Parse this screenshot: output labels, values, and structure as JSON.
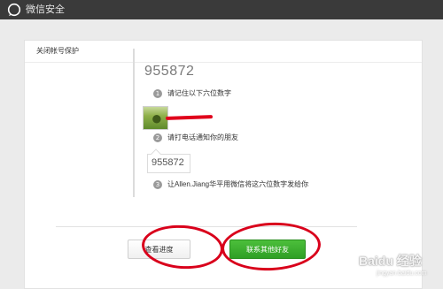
{
  "app": {
    "title": "微信安全"
  },
  "panel": {
    "title": "关闭帐号保护"
  },
  "steps": [
    {
      "num": "1",
      "text": "请记住以下六位数字",
      "code": "955872"
    },
    {
      "num": "2",
      "text": "请打电话通知你的朋友"
    },
    {
      "num": "3",
      "text": "让Allen.Jiang华平用微信将这六位数字发给你",
      "code": "955872"
    }
  ],
  "buttons": {
    "check_progress": "查看进度",
    "contact_others": "联系其他好友"
  },
  "watermark": {
    "brand": "Baidu 经验",
    "url": "jingyan.baidu.com"
  },
  "colors": {
    "topbar": "#3a3a3a",
    "primary_green": "#3bb02e",
    "annotation_red": "#d9001b"
  }
}
